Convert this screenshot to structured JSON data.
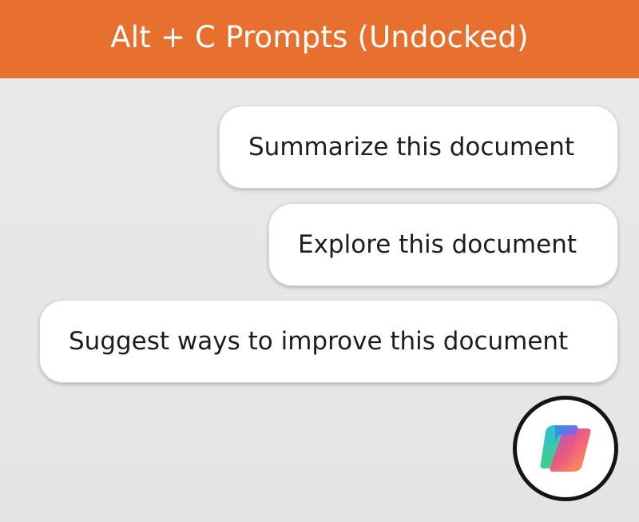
{
  "header": {
    "title": "Alt + C Prompts (Undocked)",
    "background_color": "#e8702f"
  },
  "prompts": [
    {
      "label": "Summarize this document"
    },
    {
      "label": "Explore this document"
    },
    {
      "label": "Suggest ways to improve this document"
    }
  ],
  "copilot_button": {
    "icon": "copilot-icon"
  }
}
